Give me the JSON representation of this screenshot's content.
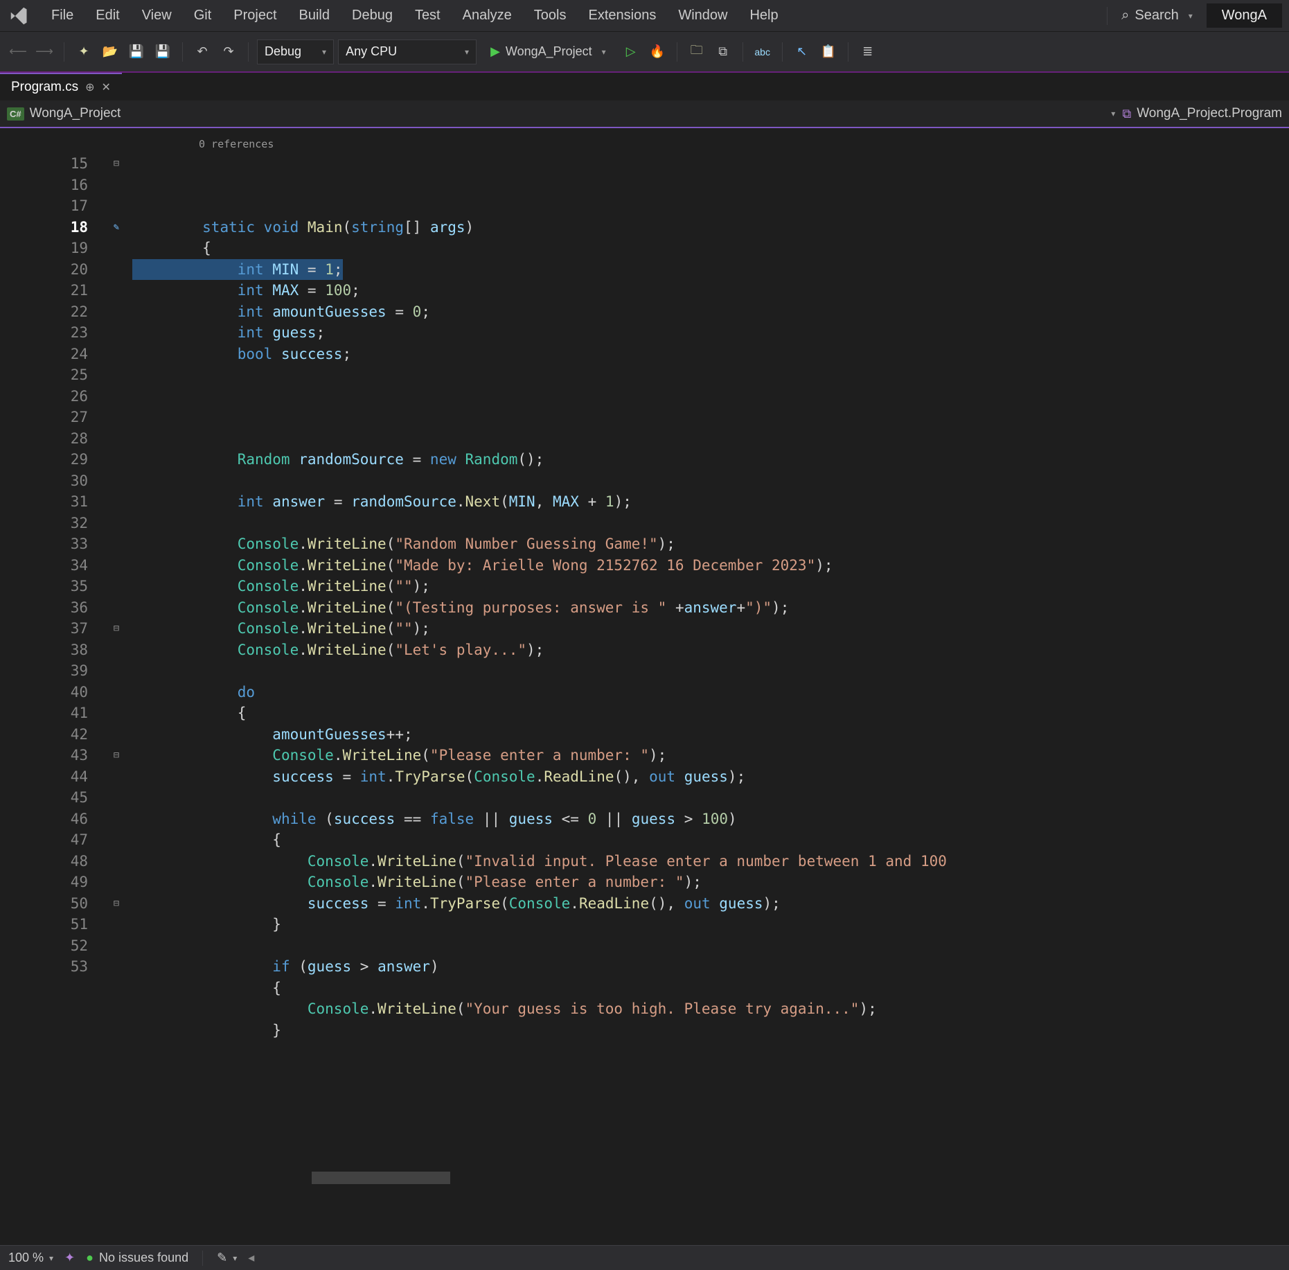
{
  "menubar": {
    "items": [
      "File",
      "Edit",
      "View",
      "Git",
      "Project",
      "Build",
      "Debug",
      "Test",
      "Analyze",
      "Tools",
      "Extensions",
      "Window",
      "Help"
    ],
    "search_label": "Search",
    "user": "WongA"
  },
  "toolbar": {
    "config_dropdown": "Debug",
    "platform_dropdown": "Any CPU",
    "start_label": "WongA_Project"
  },
  "tab": {
    "filename": "Program.cs"
  },
  "navbar": {
    "project": "WongA_Project",
    "symbol": "WongA_Project.Program"
  },
  "editor": {
    "codelens": "0 references",
    "line_start": 15,
    "line_end": 53,
    "current_line": 18,
    "lines": [
      {
        "n": 15,
        "fold": "−",
        "html": "        <span class='kw'>static</span> <span class='kw'>void</span> <span class='method'>Main</span><span class='punct'>(</span><span class='kw'>string</span><span class='punct'>[]</span> <span class='ident'>args</span><span class='punct'>)</span>"
      },
      {
        "n": 16,
        "html": "        <span class='punct'>{</span>"
      },
      {
        "n": 17,
        "selected": true,
        "html": "            <span class='kw'>int</span> <span class='ident'>MIN</span> <span class='op'>=</span> <span class='num'>1</span><span class='punct'>;</span>"
      },
      {
        "n": 18,
        "current": true,
        "html": "            <span class='kw'>int</span> <span class='ident'>MAX</span> <span class='op'>=</span> <span class='num'>100</span><span class='punct'>;</span>"
      },
      {
        "n": 19,
        "html": "            <span class='kw'>int</span> <span class='ident'>amountGuesses</span> <span class='op'>=</span> <span class='num'>0</span><span class='punct'>;</span>"
      },
      {
        "n": 20,
        "html": "            <span class='kw'>int</span> <span class='ident'>guess</span><span class='punct'>;</span>"
      },
      {
        "n": 21,
        "html": "            <span class='kw'>bool</span> <span class='ident'>success</span><span class='punct'>;</span>"
      },
      {
        "n": 22,
        "html": ""
      },
      {
        "n": 23,
        "html": ""
      },
      {
        "n": 24,
        "html": ""
      },
      {
        "n": 25,
        "html": ""
      },
      {
        "n": 26,
        "html": "            <span class='type'>Random</span> <span class='ident'>randomSource</span> <span class='op'>=</span> <span class='kw'>new</span> <span class='type'>Random</span><span class='punct'>();</span>"
      },
      {
        "n": 27,
        "html": ""
      },
      {
        "n": 28,
        "html": "            <span class='kw'>int</span> <span class='ident'>answer</span> <span class='op'>=</span> <span class='ident'>randomSource</span><span class='punct'>.</span><span class='method'>Next</span><span class='punct'>(</span><span class='ident'>MIN</span><span class='punct'>,</span> <span class='ident'>MAX</span> <span class='op'>+</span> <span class='num'>1</span><span class='punct'>);</span>"
      },
      {
        "n": 29,
        "html": ""
      },
      {
        "n": 30,
        "html": "            <span class='type'>Console</span><span class='punct'>.</span><span class='method'>WriteLine</span><span class='punct'>(</span><span class='str'>\"Random Number Guessing Game!\"</span><span class='punct'>);</span>"
      },
      {
        "n": 31,
        "html": "            <span class='type'>Console</span><span class='punct'>.</span><span class='method'>WriteLine</span><span class='punct'>(</span><span class='str'>\"Made by: Arielle Wong 2152762 16 December 2023\"</span><span class='punct'>);</span>"
      },
      {
        "n": 32,
        "html": "            <span class='type'>Console</span><span class='punct'>.</span><span class='method'>WriteLine</span><span class='punct'>(</span><span class='str'>\"\"</span><span class='punct'>);</span>"
      },
      {
        "n": 33,
        "html": "            <span class='type'>Console</span><span class='punct'>.</span><span class='method'>WriteLine</span><span class='punct'>(</span><span class='str'>\"(Testing purposes: answer is \"</span> <span class='op'>+</span><span class='ident'>answer</span><span class='op'>+</span><span class='str'>\")\"</span><span class='punct'>);</span>"
      },
      {
        "n": 34,
        "html": "            <span class='type'>Console</span><span class='punct'>.</span><span class='method'>WriteLine</span><span class='punct'>(</span><span class='str'>\"\"</span><span class='punct'>);</span>"
      },
      {
        "n": 35,
        "html": "            <span class='type'>Console</span><span class='punct'>.</span><span class='method'>WriteLine</span><span class='punct'>(</span><span class='str'>\"Let's play...\"</span><span class='punct'>);</span>"
      },
      {
        "n": 36,
        "html": ""
      },
      {
        "n": 37,
        "fold": "−",
        "html": "            <span class='kw'>do</span>"
      },
      {
        "n": 38,
        "html": "            <span class='punct'>{</span>"
      },
      {
        "n": 39,
        "html": "                <span class='ident'>amountGuesses</span><span class='op'>++</span><span class='punct'>;</span>"
      },
      {
        "n": 40,
        "html": "                <span class='type'>Console</span><span class='punct'>.</span><span class='method'>WriteLine</span><span class='punct'>(</span><span class='str'>\"Please enter a number: \"</span><span class='punct'>);</span>"
      },
      {
        "n": 41,
        "html": "                <span class='ident'>success</span> <span class='op'>=</span> <span class='kw'>int</span><span class='punct'>.</span><span class='method'>TryParse</span><span class='punct'>(</span><span class='type'>Console</span><span class='punct'>.</span><span class='method'>ReadLine</span><span class='punct'>(),</span> <span class='kw'>out</span> <span class='ident'>guess</span><span class='punct'>);</span>"
      },
      {
        "n": 42,
        "html": ""
      },
      {
        "n": 43,
        "fold": "−",
        "html": "                <span class='kw'>while</span> <span class='punct'>(</span><span class='ident'>success</span> <span class='op'>==</span> <span class='kw'>false</span> <span class='op'>||</span> <span class='ident'>guess</span> <span class='op'>&lt;=</span> <span class='num'>0</span> <span class='op'>||</span> <span class='ident'>guess</span> <span class='op'>&gt;</span> <span class='num'>100</span><span class='punct'>)</span>"
      },
      {
        "n": 44,
        "html": "                <span class='punct'>{</span>"
      },
      {
        "n": 45,
        "html": "                    <span class='type'>Console</span><span class='punct'>.</span><span class='method'>WriteLine</span><span class='punct'>(</span><span class='str'>\"Invalid input. Please enter a number between 1 and 100</span>"
      },
      {
        "n": 46,
        "html": "                    <span class='type'>Console</span><span class='punct'>.</span><span class='method'>WriteLine</span><span class='punct'>(</span><span class='str'>\"Please enter a number: \"</span><span class='punct'>);</span>"
      },
      {
        "n": 47,
        "html": "                    <span class='ident'>success</span> <span class='op'>=</span> <span class='kw'>int</span><span class='punct'>.</span><span class='method'>TryParse</span><span class='punct'>(</span><span class='type'>Console</span><span class='punct'>.</span><span class='method'>ReadLine</span><span class='punct'>(),</span> <span class='kw'>out</span> <span class='ident'>guess</span><span class='punct'>);</span>"
      },
      {
        "n": 48,
        "html": "                <span class='punct'>}</span>"
      },
      {
        "n": 49,
        "html": ""
      },
      {
        "n": 50,
        "fold": "−",
        "html": "                <span class='kw'>if</span> <span class='punct'>(</span><span class='ident'>guess</span> <span class='op'>&gt;</span> <span class='ident'>answer</span><span class='punct'>)</span>"
      },
      {
        "n": 51,
        "html": "                <span class='punct'>{</span>"
      },
      {
        "n": 52,
        "html": "                    <span class='type'>Console</span><span class='punct'>.</span><span class='method'>WriteLine</span><span class='punct'>(</span><span class='str'>\"Your guess is too high. Please try again...\"</span><span class='punct'>);</span>"
      },
      {
        "n": 53,
        "html": "                <span class='punct'>}</span>"
      }
    ]
  },
  "statusbar": {
    "zoom": "100 %",
    "issues": "No issues found"
  }
}
